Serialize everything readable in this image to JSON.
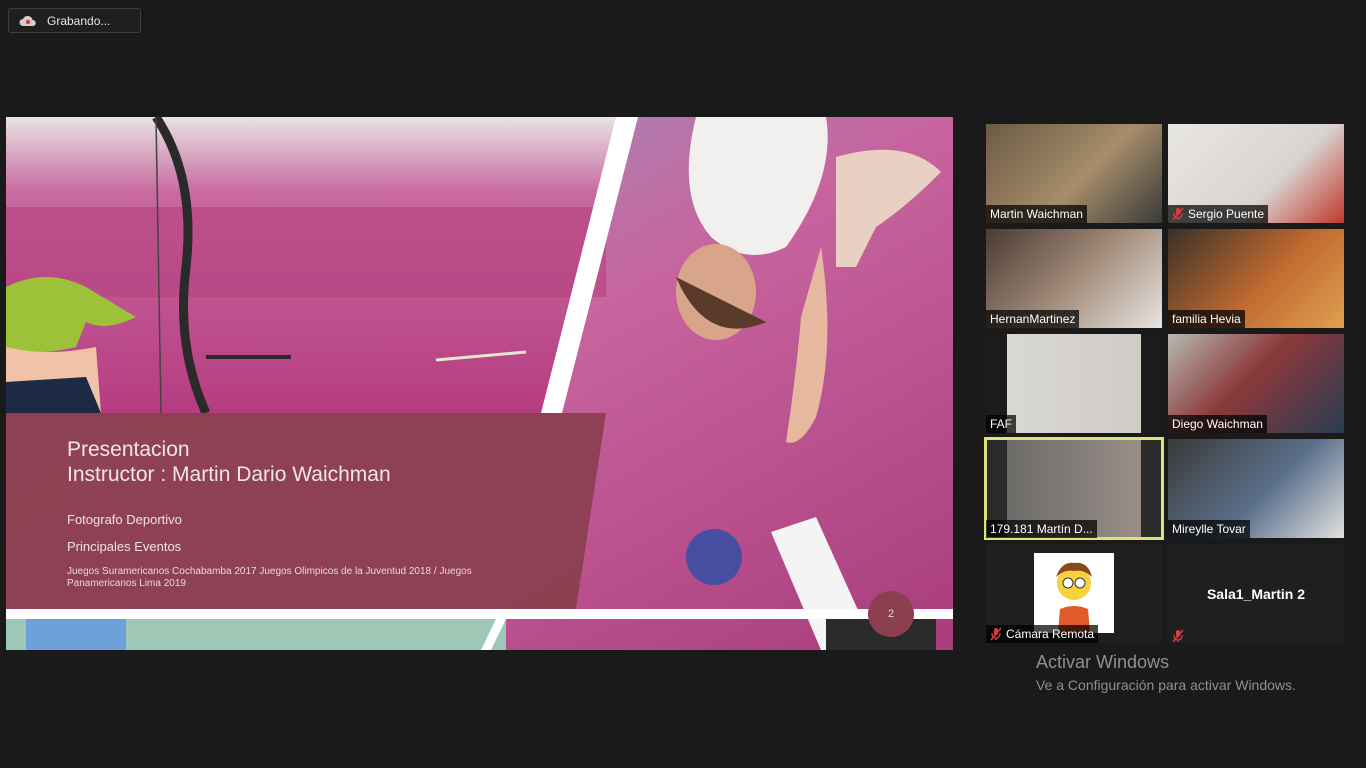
{
  "recording": {
    "label": "Grabando..."
  },
  "slide": {
    "title_line1": "Presentacion",
    "title_line2": "Instructor : Martin Dario Waichman",
    "line1": "Fotografo Deportivo",
    "line2": "Principales Eventos",
    "line3": "Juegos Suramericanos Cochabamba 2017  Juegos Olimpicos de la Juventud 2018 / Juegos Panamericanos Lima 2019",
    "page": "2"
  },
  "participants": [
    {
      "name": "Martin Waichman",
      "muted": false
    },
    {
      "name": "Sergio Puente",
      "muted": true
    },
    {
      "name": "HernanMartinez",
      "muted": false
    },
    {
      "name": "familia Hevia",
      "muted": false
    },
    {
      "name": "FAF",
      "muted": false
    },
    {
      "name": "Diego Waichman",
      "muted": false
    },
    {
      "name": "179.181 Martín D...",
      "muted": false,
      "active": true
    },
    {
      "name": "Mireylle Tovar",
      "muted": false
    },
    {
      "name": "Cámara Remota",
      "muted": true
    },
    {
      "name": "",
      "muted": true,
      "center_label": "Sala1_Martin 2"
    }
  ],
  "watermark": {
    "title": "Activar Windows",
    "subtitle": "Ve a Configuración para activar Windows."
  },
  "colors": {
    "active_speaker": "#dfe27a",
    "slide_panel": "#8c4052",
    "muted": "#e0393e"
  }
}
